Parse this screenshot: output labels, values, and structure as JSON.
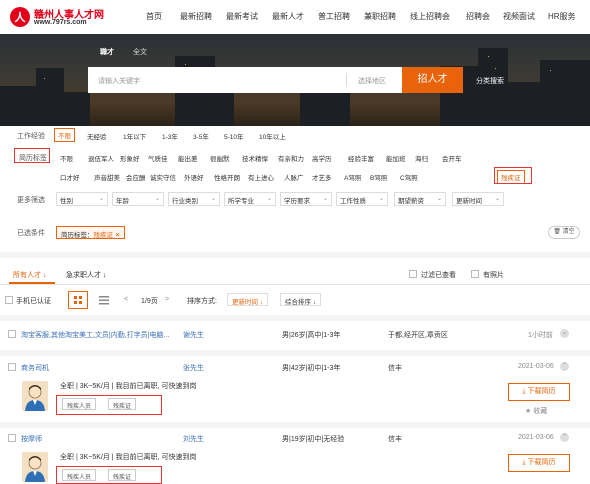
{
  "brand": {
    "name": "赣州人事人才网",
    "url": "www.797rs.com"
  },
  "nav": [
    "首页",
    "最新招聘",
    "最新考试",
    "最新人才",
    "普工招聘",
    "兼职招聘",
    "线上招聘会",
    "招聘会",
    "视频面试",
    "HR服务"
  ],
  "search": {
    "tabs": [
      "職才",
      "全文"
    ],
    "placeholder": "请输入关键字",
    "area": "选择地区",
    "button": "招人才",
    "classify": "分类搜索"
  },
  "filters": {
    "work_exp": {
      "label": "工作经验",
      "options": [
        "不限",
        "无经验",
        "1年以下",
        "1-3年",
        "3-5年",
        "5-10年",
        "10年以上"
      ]
    },
    "tags": {
      "label": "简历标签",
      "row1": [
        "不限",
        "退伍军人",
        "形象好",
        "气质佳",
        "能出差",
        "很幽默",
        "技术精悍",
        "有亲和力",
        "高学历",
        "经验丰富",
        "能加班",
        "海归",
        "会开车"
      ],
      "row2": [
        "口才好",
        "声音甜美",
        "会应酬",
        "诚实守信",
        "外语好",
        "性格开朗",
        "有上进心",
        "人脉广",
        "才艺多",
        "A驾照",
        "B驾照",
        "C驾照",
        "残疾证"
      ]
    },
    "more": {
      "label": "更多筛选",
      "dropdowns": [
        "性别",
        "年龄",
        "行业类别",
        "所学专业",
        "学历要求",
        "工作性质",
        "期望薪资",
        "更新时间"
      ]
    },
    "selected": {
      "label": "已选条件",
      "chip_key": "简历标签：",
      "chip_val": "残疾证",
      "clear": "清空"
    }
  },
  "tabs": {
    "all": "所有人才",
    "urgent": "急求职人才",
    "filter_viewed": "过滤已查看",
    "photo": "有照片"
  },
  "toolbar": {
    "verified": "手机已认证",
    "page": "1/9页",
    "sort_label": "排序方式:",
    "sort_time": "更新时间",
    "sort_all": "综合排序"
  },
  "rows": [
    {
      "title": "淘宝客服,其他淘宝美工,文员|内勤,打字员|电脑...",
      "name": "谢先生",
      "info": "男|26岁|高中|1-3年",
      "loc": "于都,经开区,章贡区",
      "time": "1小时前"
    },
    {
      "title": "商务司机",
      "name": "张先生",
      "info": "男|42岁|初中|1-3年",
      "loc": "信丰",
      "time": "2021-03-06",
      "detail": "全职 | 3K~5K/月 | 我目前已离职, 可快速到岗",
      "tags": [
        "残疾人员",
        "残疾证"
      ],
      "download": "下载简历",
      "fav": "收藏"
    },
    {
      "title": "按摩师",
      "name": "刘先生",
      "info": "男|19岁|初中|无经验",
      "loc": "信丰",
      "time": "2021-03-06",
      "detail": "全职 | 3K~5K/月 | 我目前已离职, 可快速到岗",
      "tags": [
        "残疾人员",
        "残疾证"
      ],
      "download": "下载简历"
    }
  ]
}
